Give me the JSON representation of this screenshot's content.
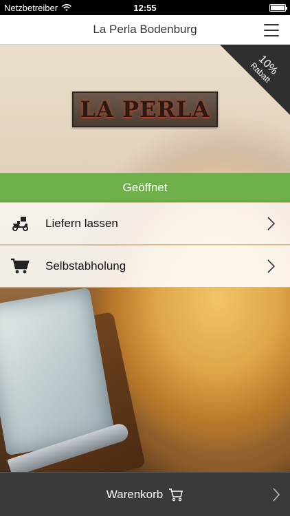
{
  "status_bar": {
    "carrier": "Netzbetreiber",
    "time": "12:55"
  },
  "nav": {
    "title": "La Perla Bodenburg"
  },
  "logo": {
    "text": "LA PERLA"
  },
  "ribbon": {
    "percent": "10%",
    "label": "Rabatt"
  },
  "status": {
    "open_label": "Geöffnet"
  },
  "options": [
    {
      "label": "Liefern lassen",
      "icon": "delivery-scooter-icon"
    },
    {
      "label": "Selbstabholung",
      "icon": "shopping-cart-icon"
    }
  ],
  "cart": {
    "label": "Warenkorb"
  },
  "colors": {
    "open_green": "#6db04a",
    "cart_bar": "#3a3a3a",
    "ribbon": "#2f2f2f"
  }
}
